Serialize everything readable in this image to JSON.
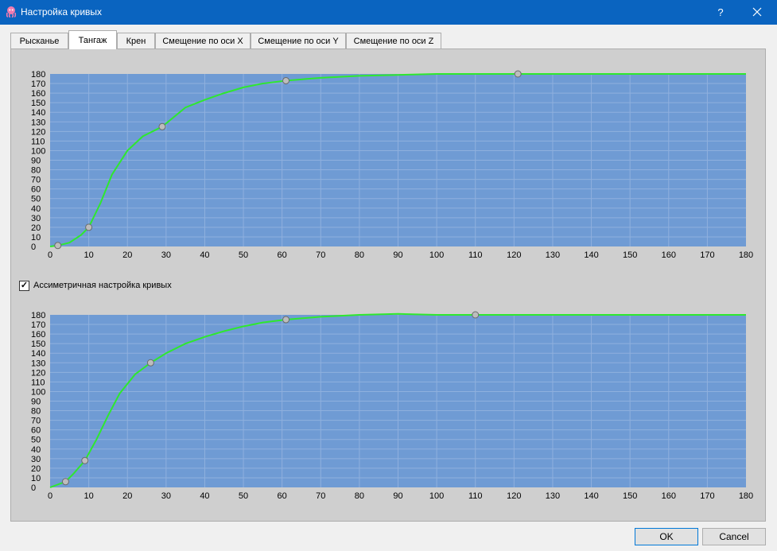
{
  "window": {
    "title": "Настройка кривых",
    "help_label": "?",
    "app_icon": "octopus-icon",
    "close_icon": "close-icon"
  },
  "tabs": [
    {
      "label": "Рысканье",
      "active": false
    },
    {
      "label": "Тангаж",
      "active": true
    },
    {
      "label": "Крен",
      "active": false
    },
    {
      "label": "Смещение по оси X",
      "active": false
    },
    {
      "label": "Смещение по оси Y",
      "active": false
    },
    {
      "label": "Смещение по оси Z",
      "active": false
    }
  ],
  "asymmetric": {
    "label": "Ассиметричная настройка кривых",
    "checked": true,
    "check_glyph": "✓"
  },
  "buttons": {
    "ok": "OK",
    "cancel": "Cancel"
  },
  "colors": {
    "plot_bg": "#6f9bd4",
    "grid": "#8fb0de",
    "curve": "#2ee82e",
    "point": "#bdbdbd"
  },
  "chart_data": [
    {
      "type": "line",
      "title": "",
      "xlabel": "",
      "ylabel": "",
      "xlim": [
        0,
        180
      ],
      "ylim": [
        0,
        180
      ],
      "xticks": [
        0,
        10,
        20,
        30,
        40,
        50,
        60,
        70,
        80,
        90,
        100,
        110,
        120,
        130,
        140,
        150,
        160,
        170,
        180
      ],
      "yticks": [
        0,
        10,
        20,
        30,
        40,
        50,
        60,
        70,
        80,
        90,
        100,
        110,
        120,
        130,
        140,
        150,
        160,
        170,
        180
      ],
      "grid": true,
      "control_points": [
        [
          2,
          1
        ],
        [
          10,
          20
        ],
        [
          29,
          125
        ],
        [
          61,
          173
        ],
        [
          121,
          180
        ]
      ],
      "series": [
        {
          "x": [
            0,
            2,
            5,
            8,
            10,
            13,
            16,
            20,
            24,
            29,
            35,
            40,
            45,
            50,
            55,
            61,
            70,
            80,
            90,
            100,
            110,
            121,
            130,
            140,
            150,
            160,
            170,
            180
          ],
          "y": [
            0,
            1,
            4,
            12,
            20,
            45,
            75,
            100,
            115,
            125,
            145,
            153,
            160,
            166,
            170,
            173,
            176,
            178,
            179,
            180,
            180,
            180,
            180,
            180,
            180,
            180,
            180,
            180
          ]
        }
      ]
    },
    {
      "type": "line",
      "title": "",
      "xlabel": "",
      "ylabel": "",
      "xlim": [
        0,
        180
      ],
      "ylim": [
        0,
        180
      ],
      "xticks": [
        0,
        10,
        20,
        30,
        40,
        50,
        60,
        70,
        80,
        90,
        100,
        110,
        120,
        130,
        140,
        150,
        160,
        170,
        180
      ],
      "yticks": [
        0,
        10,
        20,
        30,
        40,
        50,
        60,
        70,
        80,
        90,
        100,
        110,
        120,
        130,
        140,
        150,
        160,
        170,
        180
      ],
      "grid": true,
      "control_points": [
        [
          4,
          6
        ],
        [
          9,
          28
        ],
        [
          26,
          130
        ],
        [
          61,
          175
        ],
        [
          110,
          180
        ]
      ],
      "series": [
        {
          "x": [
            0,
            4,
            6,
            9,
            12,
            15,
            18,
            22,
            26,
            30,
            35,
            40,
            45,
            50,
            55,
            61,
            70,
            80,
            90,
            100,
            110,
            120,
            130,
            140,
            150,
            160,
            170,
            180
          ],
          "y": [
            0,
            6,
            14,
            28,
            50,
            75,
            98,
            118,
            130,
            140,
            150,
            157,
            163,
            168,
            172,
            175,
            178,
            180,
            181,
            180,
            180,
            180,
            180,
            180,
            180,
            180,
            180,
            180
          ]
        }
      ]
    }
  ]
}
